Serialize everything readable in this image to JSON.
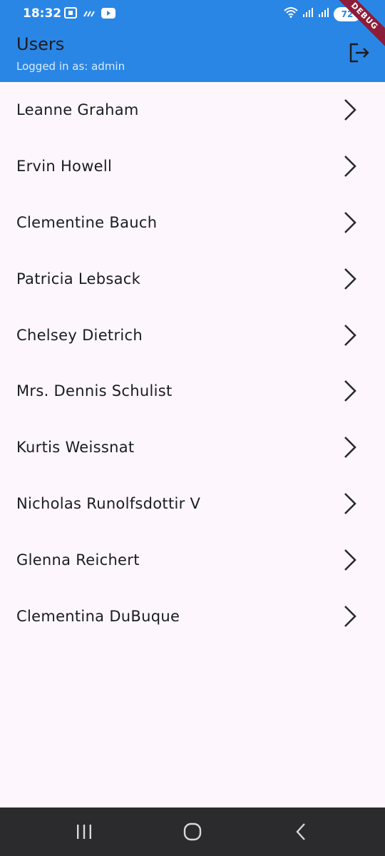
{
  "status_bar": {
    "time": "18:32",
    "battery": "72",
    "icons": [
      "screen-record-icon",
      "data-saver-icon",
      "youtube-icon",
      "wifi-icon",
      "signal-icon",
      "signal-icon",
      "battery-icon"
    ]
  },
  "debug_banner": "DEBUG",
  "appbar": {
    "title": "Users",
    "subtitle": "Logged in as: admin",
    "action_icon": "logout-icon"
  },
  "users": [
    {
      "name": "Leanne Graham"
    },
    {
      "name": "Ervin Howell"
    },
    {
      "name": "Clementine Bauch"
    },
    {
      "name": "Patricia Lebsack"
    },
    {
      "name": "Chelsey Dietrich"
    },
    {
      "name": "Mrs. Dennis Schulist"
    },
    {
      "name": "Kurtis Weissnat"
    },
    {
      "name": "Nicholas Runolfsdottir V"
    },
    {
      "name": "Glenna Reichert"
    },
    {
      "name": "Clementina DuBuque"
    }
  ],
  "nav_bar": {
    "icons": [
      "recent-apps-icon",
      "home-icon",
      "back-icon"
    ]
  },
  "colors": {
    "appbar": "#2a86e4",
    "background": "#fdf7fd",
    "nav_bar": "#2b2b2d",
    "debug_ribbon": "#8c1d3a"
  }
}
